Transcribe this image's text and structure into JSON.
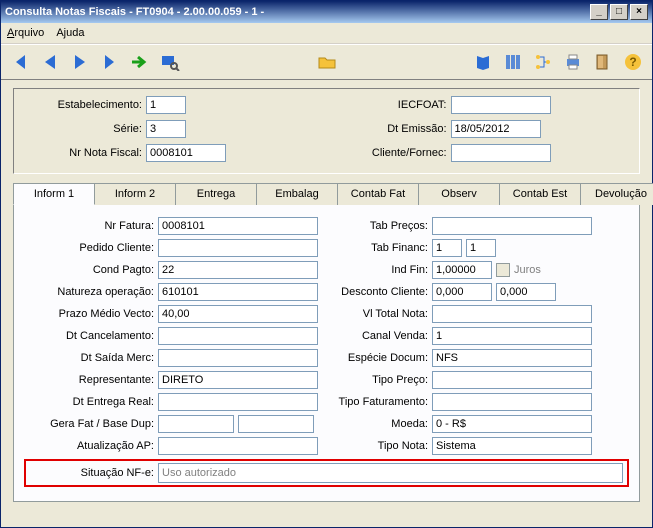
{
  "window": {
    "title": "Consulta Notas Fiscais - FT0904 - 2.00.00.059 - 1 -"
  },
  "menu": {
    "arquivo": "Arquivo",
    "ajuda": "Ajuda"
  },
  "header": {
    "estabelecimento_label": "Estabelecimento:",
    "estabelecimento": "1",
    "serie_label": "Série:",
    "serie": "3",
    "nr_nota_label": "Nr Nota Fiscal:",
    "nr_nota": "0008101",
    "iecfoat_label": "IECFOAT:",
    "iecfoat": "",
    "dt_emissao_label": "Dt Emissão:",
    "dt_emissao": "18/05/2012",
    "cliente_fornec_label": "Cliente/Fornec:",
    "cliente_fornec": ""
  },
  "tabs": {
    "inform1": "Inform 1",
    "inform2": "Inform 2",
    "entrega": "Entrega",
    "embalag": "Embalag",
    "contab_fat": "Contab Fat",
    "observ": "Observ",
    "contab_est": "Contab Est",
    "devolucao": "Devolução"
  },
  "form": {
    "nr_fatura_label": "Nr Fatura:",
    "nr_fatura": "0008101",
    "tab_precos_label": "Tab Preços:",
    "tab_precos": "",
    "pedido_cliente_label": "Pedido Cliente:",
    "pedido_cliente": "",
    "tab_financ_label": "Tab Financ:",
    "tab_financ1": "1",
    "tab_financ2": "1",
    "cond_pagto_label": "Cond Pagto:",
    "cond_pagto": "22",
    "ind_fin_label": "Ind Fin:",
    "ind_fin": "1,00000",
    "juros_label": "Juros",
    "natureza_label": "Natureza operação:",
    "natureza": "610101",
    "desc_cliente_label": "Desconto Cliente:",
    "desc_cliente1": "0,000",
    "desc_cliente2": "0,000",
    "prazo_label": "Prazo Médio Vecto:",
    "prazo": "40,00",
    "vl_total_label": "Vl Total Nota:",
    "vl_total": "",
    "dt_cancel_label": "Dt Cancelamento:",
    "dt_cancel": "",
    "canal_venda_label": "Canal Venda:",
    "canal_venda": "1",
    "dt_saida_label": "Dt Saída Merc:",
    "dt_saida": "",
    "especie_label": "Espécie Docum:",
    "especie": "NFS",
    "representante_label": "Representante:",
    "representante": "DIRETO",
    "tipo_preco_label": "Tipo Preço:",
    "tipo_preco": "",
    "dt_entrega_label": "Dt Entrega Real:",
    "dt_entrega": "",
    "tipo_fatur_label": "Tipo Faturamento:",
    "tipo_fatur": "",
    "gera_fat_label": "Gera Fat / Base Dup:",
    "gera_fat1": "",
    "gera_fat2": "",
    "moeda_label": "Moeda:",
    "moeda": "0 - R$",
    "atualiz_ap_label": "Atualização AP:",
    "atualiz_ap": "",
    "tipo_nota_label": "Tipo Nota:",
    "tipo_nota": "Sistema",
    "situacao_label": "Situação NF-e:",
    "situacao": "Uso autorizado"
  }
}
